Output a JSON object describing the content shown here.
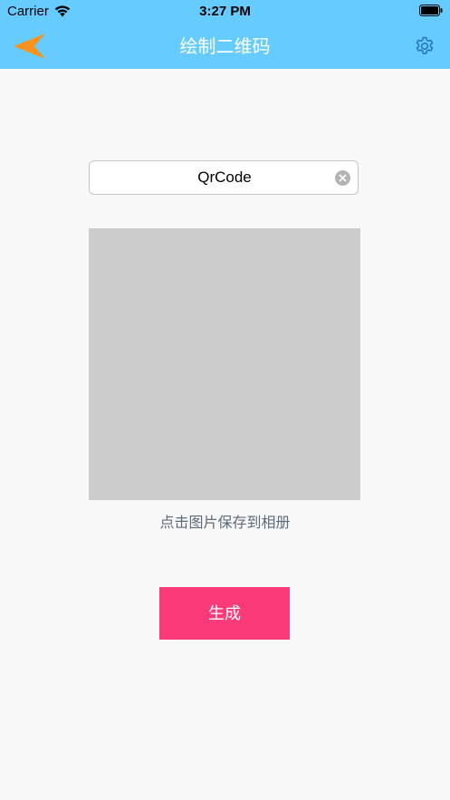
{
  "status_bar": {
    "carrier": "Carrier",
    "time": "3:27 PM"
  },
  "nav": {
    "title": "绘制二维码",
    "back_icon": "back-arrow-icon",
    "settings_icon": "gear-icon"
  },
  "form": {
    "input_value": "QrCode",
    "clear_icon": "clear-icon"
  },
  "qr": {
    "hint": "点击图片保存到相册"
  },
  "actions": {
    "generate_label": "生成"
  },
  "colors": {
    "header": "#66ccff",
    "back_arrow": "#f7931e",
    "button": "#fb3b79",
    "qr_placeholder": "#cccccc",
    "background": "#f8f8f8"
  }
}
